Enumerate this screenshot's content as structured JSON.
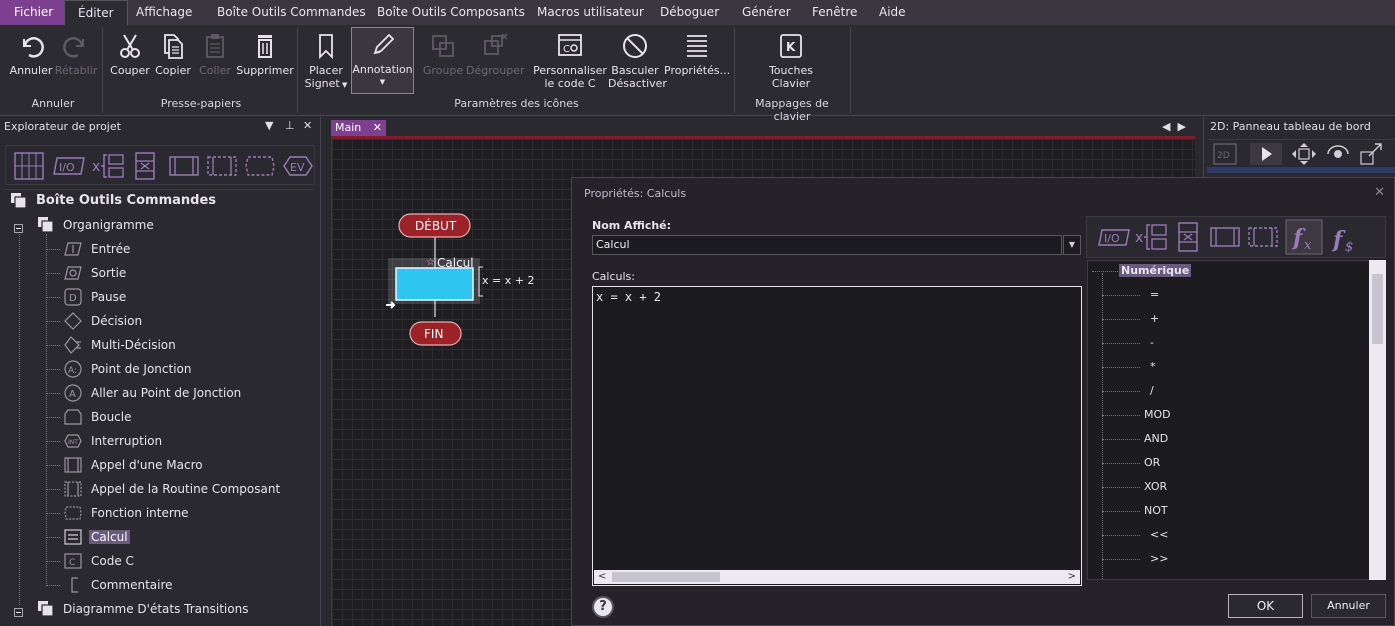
{
  "menubar": {
    "items": [
      "Fichier",
      "Éditer",
      "Affichage",
      "Boîte Outils Commandes",
      "Boîte Outils Composants",
      "Macros utilisateur",
      "Déboguer",
      "Générer",
      "Fenêtre",
      "Aide"
    ]
  },
  "ribbon": {
    "buttons": {
      "undo": "Annuler",
      "redo": "Rétablir",
      "cut": "Couper",
      "copy": "Copier",
      "paste": "Coller",
      "delete": "Supprimer",
      "bookmark_l1": "Placer",
      "bookmark_l2": "Signet",
      "annotation": "Annotation",
      "group": "Groupe",
      "ungroup": "Dégrouper",
      "customize_l1": "Personnaliser",
      "customize_l2": "le code C",
      "toggle_l1": "Basculer",
      "toggle_l2": "Désactiver",
      "properties": "Propriétés...",
      "keys_l1": "Touches",
      "keys_l2": "Clavier"
    },
    "groups": {
      "undo": "Annuler",
      "clipboard": "Presse-papiers",
      "icon_params": "Paramètres des icônes",
      "keymaps": "Mappages de clavier"
    }
  },
  "left_panel": {
    "title": "Explorateur de projet",
    "tree": {
      "root": "Boîte Outils Commandes",
      "flowchart": "Organigramme",
      "items": [
        "Entrée",
        "Sortie",
        "Pause",
        "Décision",
        "Multi-Décision",
        "Point de Jonction",
        "Aller au Point de Jonction",
        "Boucle",
        "Interruption",
        "Appel d'une Macro",
        "Appel de la Routine Composant",
        "Fonction interne",
        "Calcul",
        "Code C",
        "Commentaire"
      ],
      "state_diagram": "Diagramme D'états Transitions"
    }
  },
  "document": {
    "tab": "Main",
    "flow": {
      "start": "DÉBUT",
      "end": "FIN",
      "calc_label": "Calcul",
      "calc_expr": "x = x + 2"
    }
  },
  "right_panel": {
    "title": "2D: Panneau tableau de bord"
  },
  "dialog": {
    "title": "Propriétés: Calculs",
    "name_label": "Nom Affiché:",
    "name_value": "Calcul",
    "calc_label": "Calculs:",
    "calc_text": "x = x + 2",
    "fn_tree": {
      "header": "Numérique",
      "items": [
        "=",
        "+",
        "-",
        "*",
        "/",
        "MOD",
        "AND",
        "OR",
        "XOR",
        "NOT",
        "<<",
        ">>"
      ]
    },
    "ok": "OK",
    "cancel": "Annuler",
    "help": "?"
  },
  "colors": {
    "accent": "#7d3f8f",
    "canvas_bg": "#1e1e22",
    "flow_terminal": "#9b2226",
    "calc_fill": "#2ec5f0"
  }
}
